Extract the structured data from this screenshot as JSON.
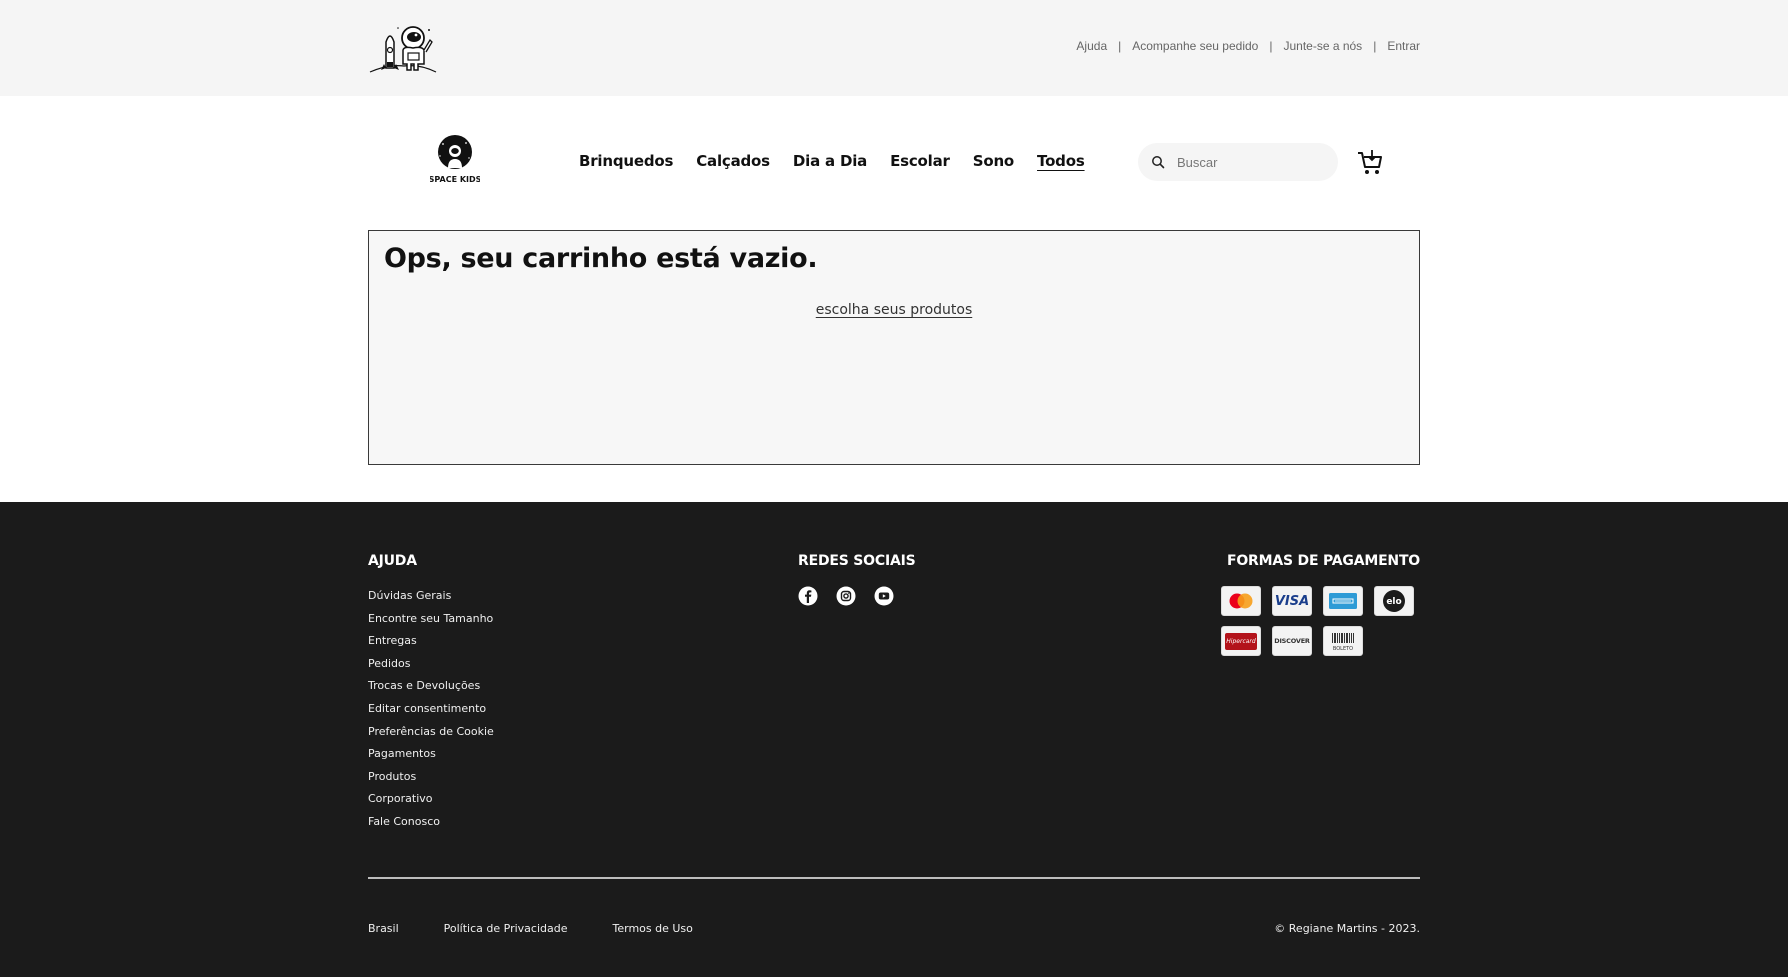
{
  "topbar": {
    "links": [
      "Ajuda",
      "Acompanhe seu pedido",
      "Junte-se a nós",
      "Entrar"
    ],
    "separator": "|"
  },
  "header": {
    "brand_text": "SPACE KIDS",
    "nav": [
      "Brinquedos",
      "Calçados",
      "Dia a Dia",
      "Escolar",
      "Sono",
      "Todos"
    ],
    "active_nav": "Todos",
    "search_placeholder": "Buscar"
  },
  "cart": {
    "empty_title": "Ops, seu carrinho está vazio.",
    "choose_link": "escolha seus produtos"
  },
  "footer": {
    "help_title": "AJUDA",
    "help_links": [
      "Dúvidas Gerais",
      "Encontre seu Tamanho",
      "Entregas",
      "Pedidos",
      "Trocas e Devoluções",
      "Editar consentimento",
      "Preferências de Cookie",
      "Pagamentos",
      "Produtos",
      "Corporativo",
      "Fale Conosco"
    ],
    "social_title": "REDES SOCIAIS",
    "social_icons": [
      "facebook-icon",
      "instagram-icon",
      "youtube-icon"
    ],
    "payment_title": "FORMAS DE PAGAMENTO",
    "payment_methods": [
      "mastercard",
      "visa",
      "amex",
      "elo",
      "hipercard",
      "discover",
      "boleto"
    ],
    "payment_labels": {
      "visa": "VISA",
      "elo": "elo",
      "hipercard": "Hipercard",
      "discover": "DISCOVER",
      "boleto": "BOLETO"
    },
    "bottom_links": [
      "Brasil",
      "Política de Privacidade",
      "Termos de Uso"
    ],
    "copyright": "© Regiane Martins - 2023."
  },
  "colors": {
    "topbar_bg": "#f5f5f5",
    "footer_bg": "#1b1b1b",
    "cartbox_bg": "#f7f7f7"
  }
}
